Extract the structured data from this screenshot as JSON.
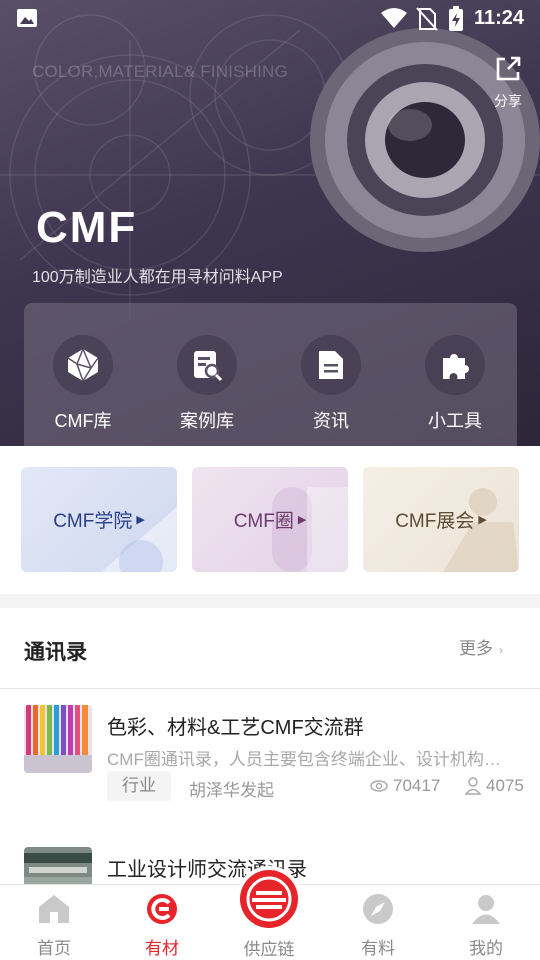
{
  "status_bar": {
    "time": "11:24"
  },
  "hero": {
    "subtitle": "COLOR,MATERIAL& FINISHING",
    "share_label": "分享",
    "logo_text": "CMF",
    "slogan": "100万制造业人都在用寻材问料APP"
  },
  "quick_nav": [
    {
      "label": "CMF库",
      "icon": "polyhedron-icon"
    },
    {
      "label": "案例库",
      "icon": "document-search-icon"
    },
    {
      "label": "资讯",
      "icon": "article-icon"
    },
    {
      "label": "小工具",
      "icon": "puzzle-icon"
    }
  ],
  "promos": [
    {
      "label": "CMF学院"
    },
    {
      "label": "CMF圈"
    },
    {
      "label": "CMF展会"
    }
  ],
  "contacts": {
    "title": "通讯录",
    "more_label": "更多",
    "groups": [
      {
        "title": "色彩、材料&工艺CMF交流群",
        "desc": "CMF圈通讯录，人员主要包含终端企业、设计机构…",
        "tag": "行业",
        "starter": "胡泽华发起",
        "views": "70417",
        "members": "4075"
      },
      {
        "title": "工业设计师交流通讯录"
      }
    ]
  },
  "tabbar": {
    "items": [
      "首页",
      "有材",
      "供应链",
      "有料",
      "我的"
    ],
    "active": "有材"
  },
  "colors": {
    "accent": "#e8242b",
    "hero_bg": "#3e3650"
  }
}
